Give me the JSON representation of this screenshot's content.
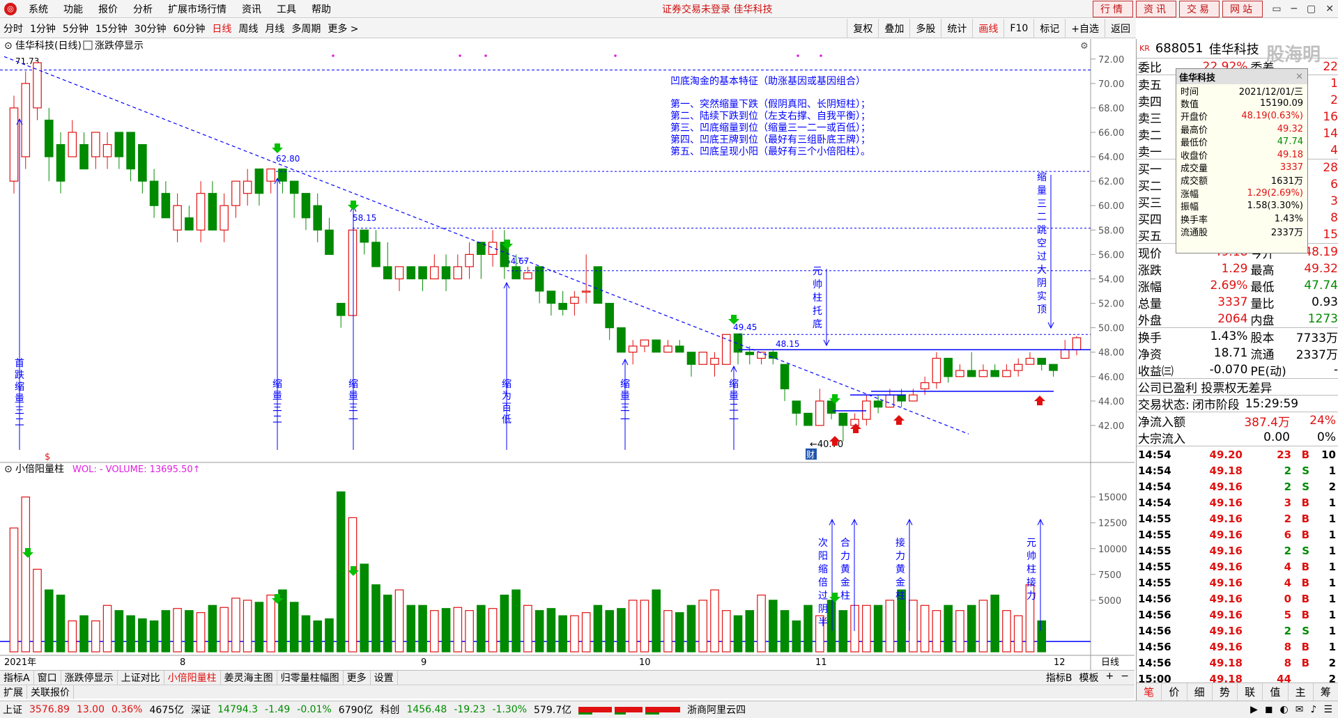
{
  "menu": {
    "logo_glyph": "◎",
    "items": [
      "系统",
      "功能",
      "报价",
      "分析",
      "扩展市场行情",
      "资讯",
      "工具",
      "帮助"
    ],
    "center_title": "证券交易未登录  佳华科技",
    "right_buttons": [
      "行情",
      "资讯",
      "交易",
      "网站"
    ],
    "window_controls": [
      "▭",
      "─",
      "▢",
      "✕"
    ]
  },
  "periods": {
    "items": [
      "分时",
      "1分钟",
      "5分钟",
      "15分钟",
      "30分钟",
      "60分钟",
      "日线",
      "周线",
      "月线",
      "多周期",
      "更多 >"
    ],
    "active": "日线",
    "tools": [
      "复权",
      "叠加",
      "多股",
      "统计",
      "画线",
      "F10",
      "标记",
      "+自选",
      "返回"
    ],
    "tools_active": "画线"
  },
  "chart": {
    "title": "佳华科技(日线)",
    "title_icon": "⊙",
    "indicator_toggle": "涨跌停显示",
    "gear_glyph": "⚙",
    "high_label": "71.73",
    "low_label": "←40.70",
    "peak_labels": [
      "62.80",
      "58.15",
      "54.67",
      "49.45",
      "48.15"
    ],
    "price_axis": [
      "72.00",
      "70.00",
      "68.00",
      "66.00",
      "64.00",
      "62.00",
      "60.00",
      "58.00",
      "56.00",
      "54.00",
      "52.00",
      "50.00",
      "48.00",
      "46.00",
      "44.00",
      "42.00"
    ],
    "annotation_title": "凹底淘金的基本特征（助涨基因或基因组合）",
    "annotation_lines": [
      "第一、突然缩量下跌（假阴真阳、长阴短柱）；",
      "第二、陆续下跌到位（左支右撑、自我平衡）；",
      "第三、凹底缩量到位（缩量三一二一或百低）；",
      "第四、凹底王牌到位（最好有三组卧底王牌）；",
      "第五、凹底呈现小阳（最好有三个小倍阳柱）。"
    ],
    "vertical_notes": [
      "首跌缩量三二",
      "缩量三二",
      "缩量三一",
      "缩为百低",
      "缩量三一",
      "缩量二一",
      "元帅柱托底",
      "缩量三二跳空过大阴实顶"
    ],
    "icon_dollar": "$",
    "icon_cai": "财"
  },
  "volume": {
    "title": "小倍阳量柱",
    "label": "WOL: - VOLUME: 13695.50↑",
    "axis": [
      "15000",
      "12500",
      "10000",
      "7500",
      "5000"
    ],
    "vertical_notes": [
      "次阳缩倍过阴半",
      "合力黄金柱",
      "接力黄金柱",
      "元帅柱接力"
    ],
    "date_labels": [
      "2021年",
      "8",
      "9",
      "10",
      "11",
      "12"
    ],
    "axis_unit": "日线"
  },
  "bottom": {
    "tabs": [
      "指标A",
      "窗口",
      "涨跌停显示",
      "上证对比",
      "小倍阳量柱",
      "姜灵海主图",
      "归零量柱幅图",
      "更多",
      "设置"
    ],
    "active_tab": "小倍阳量柱",
    "right": [
      "指标B",
      "模板",
      "+",
      "−"
    ],
    "tabs2": [
      "扩展",
      "关联报价"
    ]
  },
  "status": {
    "sh_label": "上证",
    "sh_value": "3576.89",
    "sh_chg": "13.00",
    "sh_pct": "0.36%",
    "sh_amt": "4675亿",
    "sz_label": "深证",
    "sz_value": "14794.3",
    "sz_chg": "-1.49",
    "sz_pct": "-0.01%",
    "sz_amt": "6790亿",
    "kc_label": "科创",
    "kc_value": "1456.48",
    "kc_chg": "-19.23",
    "kc_pct": "-1.30%",
    "kc_amt": "579.7亿",
    "server": "浙商阿里云四",
    "icons": [
      "▶",
      "◼",
      "◐",
      "✉",
      "♪",
      "☰"
    ]
  },
  "quote": {
    "market_tag": "KR",
    "code": "688051",
    "name": "佳华科技",
    "watermark": "股海明灯",
    "weibi_label": "委比",
    "weibi": "22.92%",
    "weicha_label": "委差",
    "weicha": "22",
    "sell_labels": [
      "卖五",
      "卖四",
      "卖三",
      "卖二",
      "卖一"
    ],
    "sell_right": [
      "1",
      "2",
      "16",
      "14",
      "4"
    ],
    "buy_labels": [
      "买一",
      "买二",
      "买三",
      "买四",
      "买五"
    ],
    "buy_right": [
      "28",
      "6",
      "3",
      "8",
      "15"
    ],
    "rows1": [
      {
        "l": "现价",
        "v": "49.18",
        "r": "今开",
        "rv": "48.19"
      },
      {
        "l": "涨跌",
        "v": "1.29",
        "r": "最高",
        "rv": "49.32"
      },
      {
        "l": "涨幅",
        "v": "2.69%",
        "r": "最低",
        "rv": "47.74"
      },
      {
        "l": "总量",
        "v": "3337",
        "r": "量比",
        "rv": "0.93"
      },
      {
        "l": "外盘",
        "v": "2064",
        "r": "内盘",
        "rv": "1273"
      }
    ],
    "rows2": [
      {
        "l": "换手",
        "v": "1.43%",
        "r": "股本",
        "rv": "7733万"
      },
      {
        "l": "净资",
        "v": "18.71",
        "r": "流通",
        "rv": "2337万"
      },
      {
        "l": "收益㈢",
        "v": "-0.070",
        "r": "PE(动)",
        "rv": "-"
      }
    ],
    "notice": "公司已盈利 投票权无差异",
    "trade_state_label": "交易状态:",
    "trade_state": "闭市阶段",
    "trade_time": "15:29:59",
    "netflow_label": "净流入额",
    "netflow": "387.4万",
    "netflow_pct": "24%",
    "block_label": "大宗流入",
    "block": "0.00",
    "block_pct": "0%",
    "ticks": [
      {
        "t": "14:54",
        "p": "49.20",
        "v": "23",
        "s": "B",
        "n": "10"
      },
      {
        "t": "14:54",
        "p": "49.18",
        "v": "2",
        "s": "S",
        "n": "1"
      },
      {
        "t": "14:54",
        "p": "49.16",
        "v": "2",
        "s": "S",
        "n": "2"
      },
      {
        "t": "14:54",
        "p": "49.16",
        "v": "3",
        "s": "B",
        "n": "1"
      },
      {
        "t": "14:55",
        "p": "49.16",
        "v": "2",
        "s": "B",
        "n": "1"
      },
      {
        "t": "14:55",
        "p": "49.16",
        "v": "6",
        "s": "B",
        "n": "1"
      },
      {
        "t": "14:55",
        "p": "49.16",
        "v": "2",
        "s": "S",
        "n": "1"
      },
      {
        "t": "14:55",
        "p": "49.16",
        "v": "4",
        "s": "B",
        "n": "1"
      },
      {
        "t": "14:55",
        "p": "49.16",
        "v": "4",
        "s": "B",
        "n": "1"
      },
      {
        "t": "14:56",
        "p": "49.16",
        "v": "0",
        "s": "B",
        "n": "1"
      },
      {
        "t": "14:56",
        "p": "49.16",
        "v": "5",
        "s": "B",
        "n": "1"
      },
      {
        "t": "14:56",
        "p": "49.16",
        "v": "2",
        "s": "S",
        "n": "1"
      },
      {
        "t": "14:56",
        "p": "49.16",
        "v": "8",
        "s": "B",
        "n": "1"
      },
      {
        "t": "14:56",
        "p": "49.18",
        "v": "8",
        "s": "B",
        "n": "2"
      },
      {
        "t": "15:00",
        "p": "49.18",
        "v": "44",
        "s": "",
        "n": "2"
      }
    ],
    "tabs": [
      "笔",
      "价",
      "细",
      "势",
      "联",
      "值",
      "主",
      "筹"
    ],
    "active_tab": "笔"
  },
  "popup": {
    "title": "佳华科技",
    "close_glyph": "✕",
    "rows": [
      {
        "k": "时间",
        "v": "2021/12/01/三"
      },
      {
        "k": "数值",
        "v": "15190.09"
      },
      {
        "k": "开盘价",
        "v": "48.19(0.63%)"
      },
      {
        "k": "最高价",
        "v": "49.32"
      },
      {
        "k": "最低价",
        "v": "47.74"
      },
      {
        "k": "收盘价",
        "v": "49.18"
      },
      {
        "k": "成交量",
        "v": "3337"
      },
      {
        "k": "成交额",
        "v": "1631万"
      },
      {
        "k": "涨幅",
        "v": "1.29(2.69%)"
      },
      {
        "k": "振幅",
        "v": "1.58(3.30%)"
      },
      {
        "k": "换手率",
        "v": "1.43%"
      },
      {
        "k": "流通股",
        "v": "2337万"
      }
    ]
  },
  "chart_data": {
    "type": "candlestick",
    "ylim": [
      40,
      72.5
    ],
    "candles": [
      [
        62,
        68,
        69,
        61
      ],
      [
        64,
        70,
        71,
        63
      ],
      [
        68,
        71.7,
        71.73,
        67
      ],
      [
        67,
        64,
        68,
        62
      ],
      [
        65,
        62,
        66,
        61
      ],
      [
        64,
        66,
        67,
        64
      ],
      [
        65,
        63,
        66,
        63
      ],
      [
        64,
        66,
        66,
        63
      ],
      [
        64,
        65,
        66,
        63
      ],
      [
        66,
        64,
        66,
        63
      ],
      [
        66,
        63,
        66,
        62
      ],
      [
        65,
        62,
        65,
        61
      ],
      [
        62,
        60,
        63,
        59
      ],
      [
        61,
        59,
        62,
        59
      ],
      [
        58,
        60,
        61,
        57
      ],
      [
        59,
        58,
        60,
        58
      ],
      [
        58,
        61,
        62,
        57
      ],
      [
        61,
        58,
        62,
        58
      ],
      [
        58,
        60,
        61,
        57
      ],
      [
        60,
        62,
        62,
        59
      ],
      [
        61,
        62,
        63,
        60
      ],
      [
        63,
        61,
        63,
        60
      ],
      [
        62,
        63,
        63,
        61
      ],
      [
        63,
        62,
        63,
        61
      ],
      [
        62,
        61,
        62,
        59
      ],
      [
        61,
        59,
        61,
        58
      ],
      [
        60,
        58,
        61,
        57
      ],
      [
        58,
        56,
        59,
        56
      ],
      [
        52,
        51,
        52,
        50
      ],
      [
        51,
        58,
        58,
        51
      ],
      [
        58,
        57,
        58,
        56
      ],
      [
        57,
        55,
        58,
        55
      ],
      [
        55,
        54,
        57,
        54
      ],
      [
        54,
        55,
        55,
        53
      ],
      [
        55,
        54,
        55,
        54
      ],
      [
        55,
        54,
        55,
        53
      ],
      [
        54,
        55,
        56,
        54
      ],
      [
        55,
        54,
        56,
        53
      ],
      [
        54,
        55,
        56,
        54
      ],
      [
        55,
        56,
        57,
        54
      ],
      [
        57,
        56,
        57,
        54
      ],
      [
        56,
        57,
        58,
        55
      ],
      [
        57,
        55,
        58,
        54
      ],
      [
        55,
        54,
        56,
        54
      ],
      [
        54,
        54.5,
        55,
        54
      ],
      [
        55,
        53,
        55,
        52
      ],
      [
        53,
        52,
        53,
        51
      ],
      [
        52,
        51.5,
        53,
        51
      ],
      [
        52,
        52.5,
        53,
        51
      ],
      [
        53,
        53,
        56,
        52
      ],
      [
        55,
        52,
        55,
        52
      ],
      [
        52,
        50,
        52,
        49
      ],
      [
        50,
        48,
        50,
        48
      ],
      [
        48,
        48.5,
        49,
        47
      ],
      [
        48.5,
        49,
        49,
        48
      ],
      [
        49,
        48,
        49,
        48
      ],
      [
        48,
        48.5,
        49,
        48
      ],
      [
        48.5,
        48,
        49,
        48
      ],
      [
        48,
        47,
        48,
        46
      ],
      [
        47,
        48,
        48,
        47
      ],
      [
        47,
        47.5,
        48,
        46
      ],
      [
        47,
        49.45,
        49.45,
        47
      ],
      [
        49.5,
        48,
        49.5,
        47
      ],
      [
        48,
        47.8,
        48.5,
        47
      ],
      [
        47.5,
        48,
        48,
        47
      ],
      [
        48,
        47.5,
        48.15,
        47
      ],
      [
        47,
        45,
        47,
        44
      ],
      [
        44,
        43,
        44,
        42
      ],
      [
        43,
        42,
        43,
        42
      ],
      [
        42,
        44,
        45,
        42
      ],
      [
        44,
        43,
        44,
        42.5
      ],
      [
        43,
        42,
        43,
        40.7
      ],
      [
        42,
        42.5,
        43,
        42
      ],
      [
        42.5,
        44,
        44.5,
        42
      ],
      [
        44,
        43.5,
        44.5,
        43
      ],
      [
        43.5,
        44.5,
        45,
        43.5
      ],
      [
        44.5,
        44,
        45,
        43.5
      ],
      [
        44,
        44.5,
        45,
        44
      ],
      [
        45,
        45.5,
        46,
        44.5
      ],
      [
        45.5,
        47.5,
        48,
        45
      ],
      [
        47.5,
        46,
        47.5,
        45.5
      ],
      [
        46,
        46.5,
        47,
        46
      ],
      [
        46.5,
        46,
        48,
        46
      ],
      [
        46,
        46.5,
        47,
        46
      ],
      [
        46.5,
        46,
        47,
        46
      ],
      [
        46,
        46.5,
        47,
        46
      ],
      [
        46.5,
        47,
        47.5,
        46
      ],
      [
        47,
        47.5,
        48,
        47
      ],
      [
        47.5,
        47,
        47.5,
        46.5
      ],
      [
        47,
        46.5,
        47,
        46
      ],
      [
        47.5,
        48.19,
        49,
        47.5
      ],
      [
        48.19,
        49.18,
        49.32,
        47.74
      ]
    ],
    "volumes": [
      12000,
      15000,
      8000,
      6000,
      5500,
      3000,
      3500,
      3000,
      4500,
      4000,
      3500,
      3200,
      3000,
      4000,
      4200,
      4000,
      3800,
      4500,
      4300,
      5200,
      5000,
      4800,
      5500,
      6000,
      4800,
      3500,
      3000,
      3200,
      15500,
      13000,
      8500,
      6500,
      5500,
      6000,
      4500,
      4500,
      4000,
      4200,
      4300,
      4000,
      4500,
      4200,
      5500,
      6000,
      4500,
      4000,
      4200,
      3500,
      3500,
      3800,
      4500,
      4000,
      4200,
      5000,
      5000,
      6000,
      4000,
      3800,
      4500,
      5000,
      6000,
      4000,
      3500,
      4000,
      5500,
      5000,
      4000,
      3000,
      4500,
      3500,
      5000,
      4000,
      4500,
      4500,
      4500,
      5000,
      6000,
      5000,
      4500,
      4000,
      4500,
      4000,
      4500,
      5000,
      5500,
      4000,
      3500,
      6500,
      3000
    ],
    "vol_ylim": [
      0,
      17000
    ]
  }
}
